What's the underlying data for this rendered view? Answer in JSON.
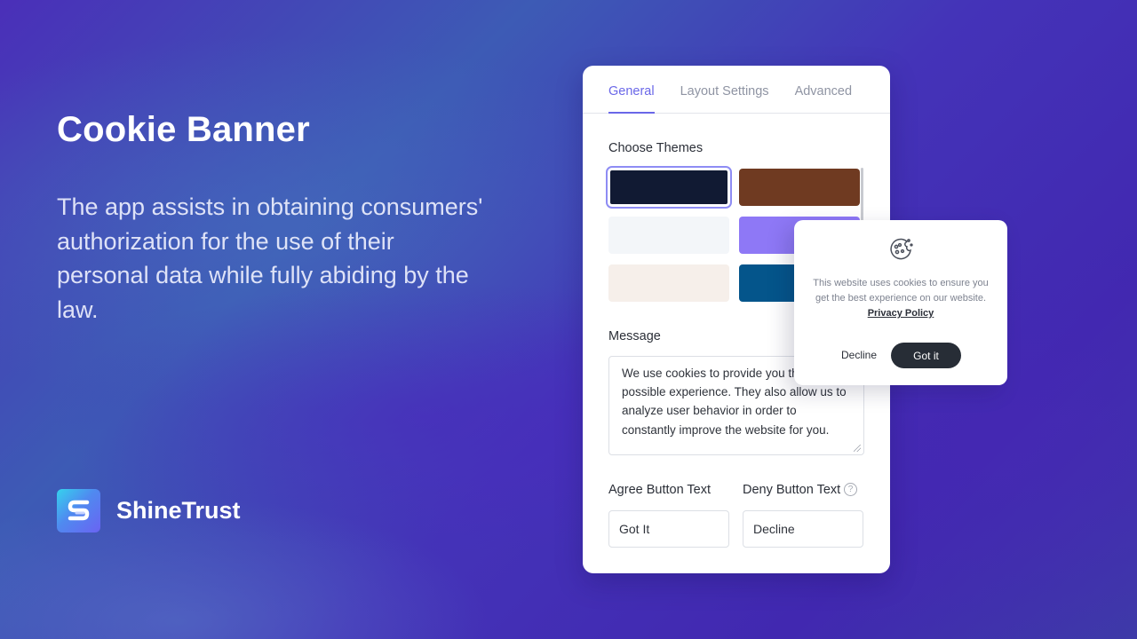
{
  "hero": {
    "title": "Cookie Banner",
    "description": "The app assists in obtaining consumers' authorization for the use of their personal data while fully abiding by the law."
  },
  "brand": {
    "name": "ShineTrust",
    "logo_icon": "shinetrust-s-logo-icon"
  },
  "settings_panel": {
    "tabs": [
      {
        "label": "General",
        "active": true
      },
      {
        "label": "Layout Settings",
        "active": false
      },
      {
        "label": "Advanced",
        "active": false
      }
    ],
    "themes_label": "Choose Themes",
    "themes": [
      {
        "name": "dark-navy",
        "color": "#111a33",
        "selected": true
      },
      {
        "name": "brown",
        "color": "#6f3a21",
        "selected": false
      },
      {
        "name": "light-gray",
        "color": "#f3f6f9",
        "selected": false
      },
      {
        "name": "purple",
        "color": "#8e78f6",
        "selected": false
      },
      {
        "name": "cream",
        "color": "#f6efea",
        "selected": false
      },
      {
        "name": "blue",
        "color": "#04558b",
        "selected": false
      }
    ],
    "message_label": "Message",
    "message_value": "We use cookies to provide you the best possible experience. They also allow us to analyze user behavior in order to constantly improve the website for you.",
    "agree_label": "Agree Button Text",
    "agree_value": "Got It",
    "deny_label": "Deny Button Text",
    "deny_value": "Decline",
    "help_glyph": "?"
  },
  "cookie_popup": {
    "icon": "cookie-icon",
    "text": "This website uses cookies to ensure you get the best experience on our website.",
    "link_label": "Privacy Policy",
    "decline_label": "Decline",
    "accept_label": "Got it"
  },
  "colors": {
    "accent": "#6a67e8",
    "dark_button": "#272d36"
  }
}
